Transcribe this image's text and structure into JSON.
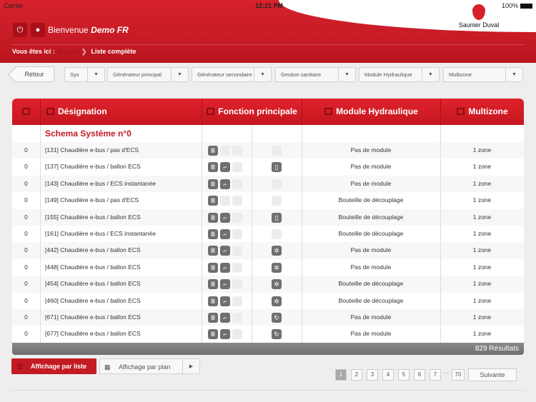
{
  "status_bar": {
    "carrier": "Carrier",
    "time": "12:21 PM",
    "battery": "100%"
  },
  "brand": "Saunier Duval",
  "header": {
    "welcome": "Bienvenue",
    "user": "Demo FR"
  },
  "breadcrumb": {
    "label": "Vous êtes ici :",
    "home": "Accueil",
    "current": "Liste complète"
  },
  "back_label": "Retour",
  "filters": [
    "Sys",
    "Générateur principal",
    "Générateur secondaire",
    "Gestion sanitaire",
    "Module Hydraulique",
    "Multizone"
  ],
  "columns": {
    "designation": "Désignation",
    "fonction": "Fonction principale",
    "module": "Module Hydraulique",
    "multizone": "Multizone"
  },
  "section_title": "Schema Système n°0",
  "rows": [
    {
      "num": "0",
      "name": "[131] Chaudière e-bus / pas d'ECS",
      "tap": false,
      "aux": "none",
      "module": "Pas de module",
      "zone": "1 zone"
    },
    {
      "num": "0",
      "name": "[137] Chaudière e-bus / ballon ECS",
      "tap": true,
      "aux": "tank",
      "module": "Pas de module",
      "zone": "1 zone"
    },
    {
      "num": "0",
      "name": "[143] Chaudière e-bus / ECS instantanée",
      "tap": true,
      "aux": "none",
      "module": "Pas de module",
      "zone": "1 zone"
    },
    {
      "num": "0",
      "name": "[149] Chaudière e-bus / pas d'ECS",
      "tap": false,
      "aux": "none",
      "module": "Bouteille de découplage",
      "zone": "1 zone"
    },
    {
      "num": "0",
      "name": "[155] Chaudière e-bus / ballon ECS",
      "tap": true,
      "aux": "tank",
      "module": "Bouteille de découplage",
      "zone": "1 zone"
    },
    {
      "num": "0",
      "name": "[161] Chaudière e-bus / ECS instantanée",
      "tap": true,
      "aux": "none",
      "module": "Bouteille de découplage",
      "zone": "1 zone"
    },
    {
      "num": "0",
      "name": "[442] Chaudière e-bus / ballon ECS",
      "tap": true,
      "aux": "sun",
      "module": "Pas de module",
      "zone": "1 zone"
    },
    {
      "num": "0",
      "name": "[448] Chaudière e-bus / ballon ECS",
      "tap": true,
      "aux": "sun",
      "module": "Pas de module",
      "zone": "1 zone"
    },
    {
      "num": "0",
      "name": "[454] Chaudière e-bus / ballon ECS",
      "tap": true,
      "aux": "sun",
      "module": "Bouteille de découplage",
      "zone": "1 zone"
    },
    {
      "num": "0",
      "name": "[460] Chaudière e-bus / ballon ECS",
      "tap": true,
      "aux": "sun",
      "module": "Bouteille de découplage",
      "zone": "1 zone"
    },
    {
      "num": "0",
      "name": "[671] Chaudière e-bus / ballon ECS",
      "tap": true,
      "aux": "cycle",
      "module": "Pas de module",
      "zone": "1 zone"
    },
    {
      "num": "0",
      "name": "[677] Chaudière e-bus / ballon ECS",
      "tap": true,
      "aux": "cycle",
      "module": "Pas de module",
      "zone": "1 zone"
    }
  ],
  "results": "829 Résultats",
  "view": {
    "list": "Affichage par liste",
    "plan": "Affichage par plan"
  },
  "pagination": {
    "pages": [
      "1",
      "2",
      "3",
      "4",
      "5",
      "6",
      "7"
    ],
    "ellipsis": "···",
    "last": "70",
    "next": "Suivante",
    "current": "1"
  },
  "colors": {
    "brand_red": "#d7222d"
  }
}
